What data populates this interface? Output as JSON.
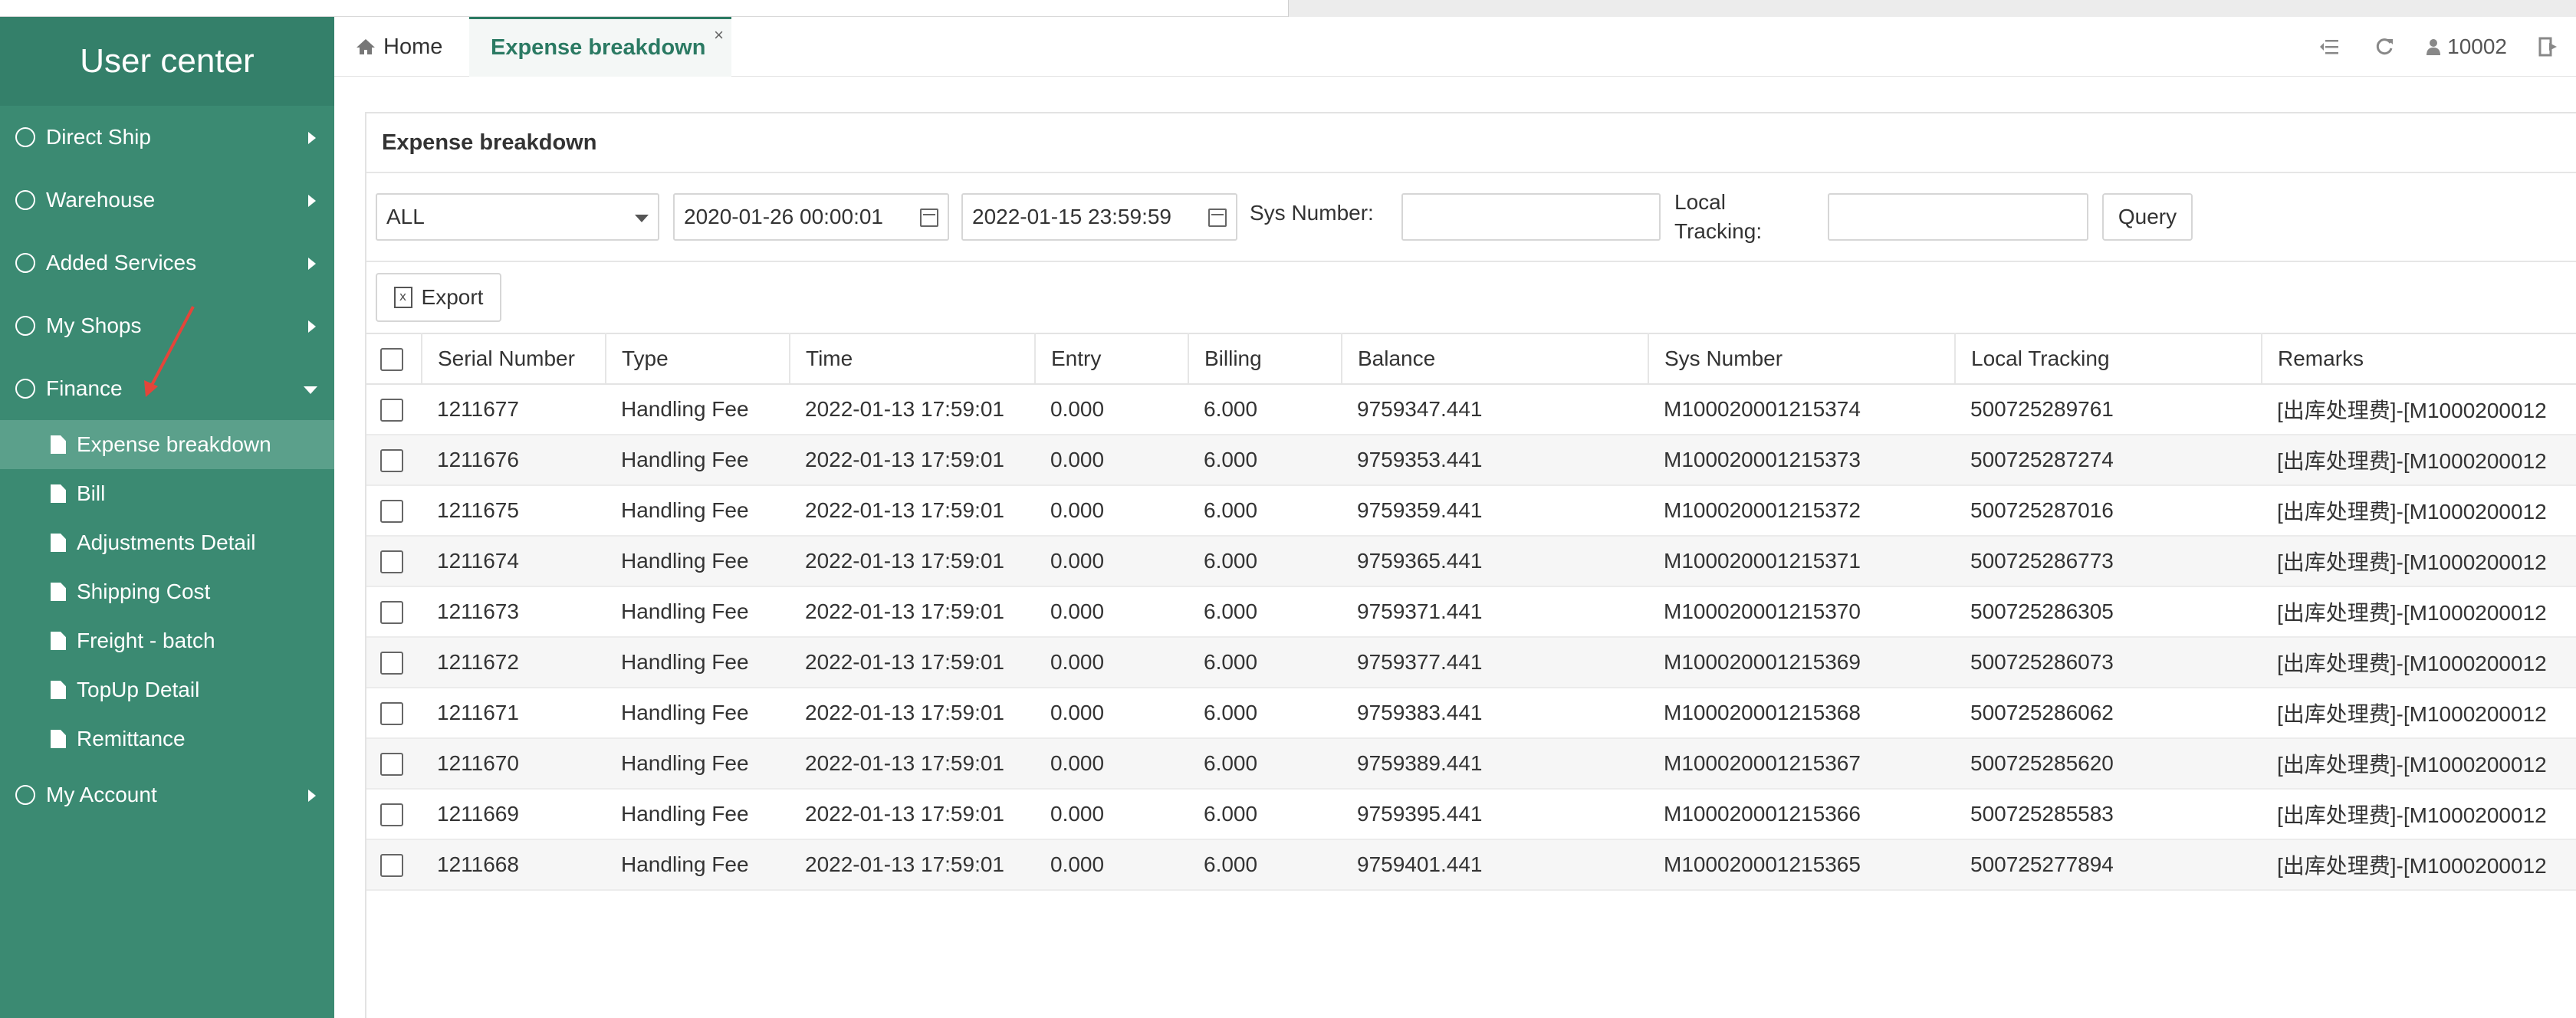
{
  "sidebar": {
    "title": "User center",
    "menu": [
      {
        "label": "Direct Ship",
        "expanded": false
      },
      {
        "label": "Warehouse",
        "expanded": false
      },
      {
        "label": "Added Services",
        "expanded": false
      },
      {
        "label": "My Shops",
        "expanded": false
      },
      {
        "label": "Finance",
        "expanded": true
      }
    ],
    "finance_items": [
      {
        "label": "Expense breakdown",
        "active": true
      },
      {
        "label": "Bill"
      },
      {
        "label": "Adjustments Detail"
      },
      {
        "label": "Shipping Cost"
      },
      {
        "label": "Freight - batch"
      },
      {
        "label": "TopUp Detail"
      },
      {
        "label": "Remittance"
      }
    ],
    "after": {
      "label": "My Account"
    }
  },
  "tabs": {
    "home": "Home",
    "active": "Expense breakdown",
    "close": "×"
  },
  "toolbar": {
    "user_id": "10002"
  },
  "panel": {
    "title": "Expense breakdown"
  },
  "filters": {
    "type_value": "ALL",
    "date_from": "2020-01-26 00:00:01",
    "date_to": "2022-01-15 23:59:59",
    "sys_number_label": "Sys Number:",
    "local_tracking_label_1": "Local",
    "local_tracking_label_2": "Tracking:",
    "query": "Query"
  },
  "export": "Export",
  "table": {
    "headers": [
      "Serial Number",
      "Type",
      "Time",
      "Entry",
      "Billing",
      "Balance",
      "Sys Number",
      "Local Tracking",
      "Remarks"
    ],
    "rows": [
      [
        "1211677",
        "Handling Fee",
        "2022-01-13 17:59:01",
        "0.000",
        "6.000",
        "9759347.441",
        "M100020001215374",
        "500725289761",
        "[出库处理费]-[M1000200012"
      ],
      [
        "1211676",
        "Handling Fee",
        "2022-01-13 17:59:01",
        "0.000",
        "6.000",
        "9759353.441",
        "M100020001215373",
        "500725287274",
        "[出库处理费]-[M1000200012"
      ],
      [
        "1211675",
        "Handling Fee",
        "2022-01-13 17:59:01",
        "0.000",
        "6.000",
        "9759359.441",
        "M100020001215372",
        "500725287016",
        "[出库处理费]-[M1000200012"
      ],
      [
        "1211674",
        "Handling Fee",
        "2022-01-13 17:59:01",
        "0.000",
        "6.000",
        "9759365.441",
        "M100020001215371",
        "500725286773",
        "[出库处理费]-[M1000200012"
      ],
      [
        "1211673",
        "Handling Fee",
        "2022-01-13 17:59:01",
        "0.000",
        "6.000",
        "9759371.441",
        "M100020001215370",
        "500725286305",
        "[出库处理费]-[M1000200012"
      ],
      [
        "1211672",
        "Handling Fee",
        "2022-01-13 17:59:01",
        "0.000",
        "6.000",
        "9759377.441",
        "M100020001215369",
        "500725286073",
        "[出库处理费]-[M1000200012"
      ],
      [
        "1211671",
        "Handling Fee",
        "2022-01-13 17:59:01",
        "0.000",
        "6.000",
        "9759383.441",
        "M100020001215368",
        "500725286062",
        "[出库处理费]-[M1000200012"
      ],
      [
        "1211670",
        "Handling Fee",
        "2022-01-13 17:59:01",
        "0.000",
        "6.000",
        "9759389.441",
        "M100020001215367",
        "500725285620",
        "[出库处理费]-[M1000200012"
      ],
      [
        "1211669",
        "Handling Fee",
        "2022-01-13 17:59:01",
        "0.000",
        "6.000",
        "9759395.441",
        "M100020001215366",
        "500725285583",
        "[出库处理费]-[M1000200012"
      ],
      [
        "1211668",
        "Handling Fee",
        "2022-01-13 17:59:01",
        "0.000",
        "6.000",
        "9759401.441",
        "M100020001215365",
        "500725277894",
        "[出库处理费]-[M1000200012"
      ]
    ]
  },
  "colors": {
    "sidebar_bg": "#3b8a72",
    "sidebar_active": "#5ba08b",
    "accent": "#2b7a63"
  }
}
